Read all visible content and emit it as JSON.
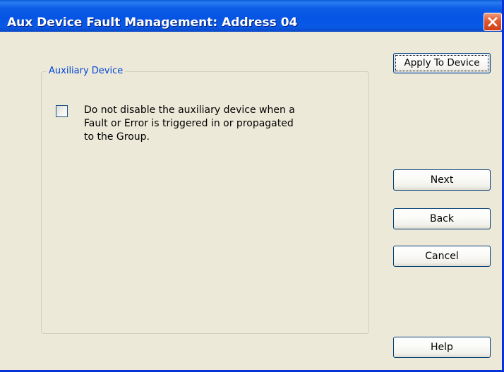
{
  "window": {
    "title": "Aux Device Fault Management: Address 04"
  },
  "group": {
    "title": "Auxiliary Device",
    "checkbox": {
      "checked": false,
      "label_lines": [
        "Do not disable the auxiliary device when a",
        "Fault or Error is triggered in or propagated",
        "to the Group."
      ]
    }
  },
  "buttons": {
    "apply": "Apply To Device",
    "next": "Next",
    "back": "Back",
    "cancel": "Cancel",
    "help": "Help"
  },
  "icons": {
    "close": "close-icon"
  },
  "colors": {
    "titlebar": "#0554e3",
    "client_background": "#ece9d8",
    "group_title_text": "#0046d5",
    "close_button": "#e2582f",
    "button_border": "#003c74"
  }
}
